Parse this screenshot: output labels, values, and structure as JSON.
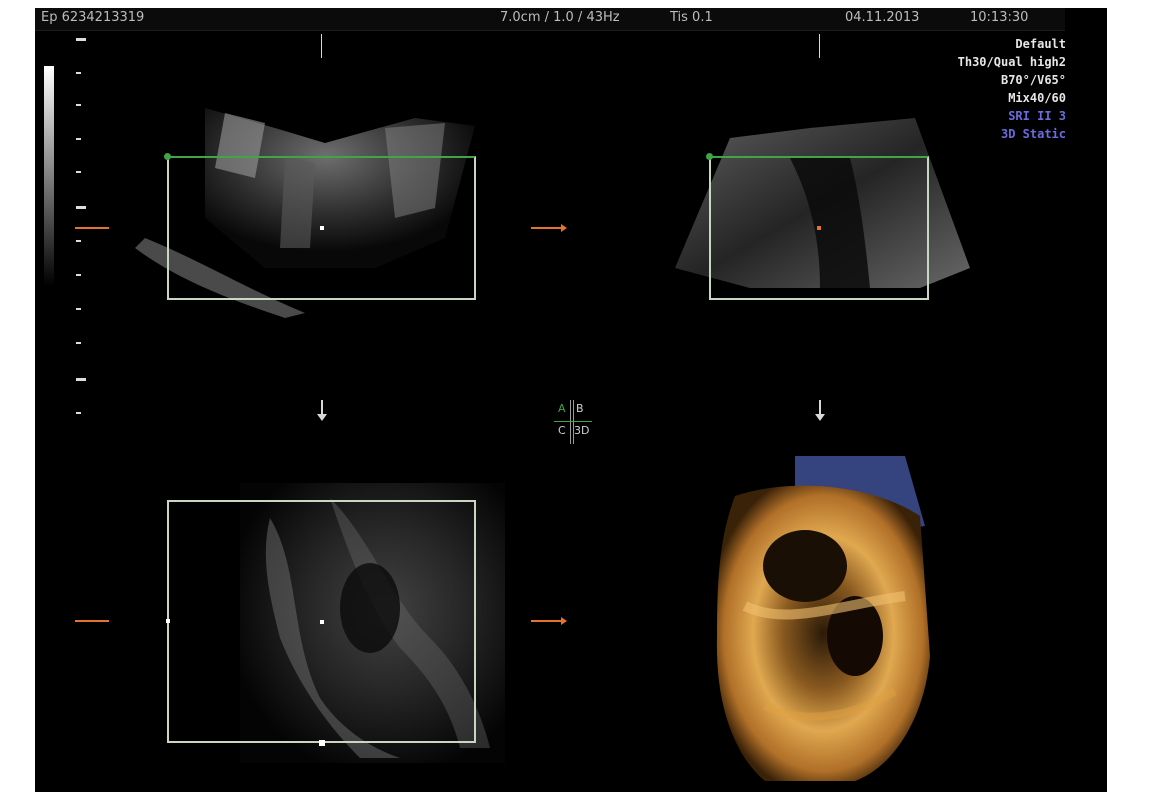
{
  "topbar": {
    "patient_id": "Ep  6234213319",
    "probe_info": "7.0cm / 1.0 / 43Hz",
    "ris": "Tis 0.1",
    "date": "04.11.2013",
    "time": "10:13:30"
  },
  "params": [
    {
      "text": "Default",
      "color": "#e6e6e6"
    },
    {
      "text": "Th30/Qual high2",
      "color": "#e6e6e6"
    },
    {
      "text": "B70°/V65°",
      "color": "#e6e6e6"
    },
    {
      "text": "Mix40/60",
      "color": "#e6e6e6"
    },
    {
      "text": "SRI II 3",
      "color": "#6b6bdf"
    },
    {
      "text": "3D Static",
      "color": "#6b6bdf"
    }
  ],
  "legend": {
    "a": "A",
    "b": "B",
    "c": "C",
    "d": "3D"
  },
  "colors": {
    "accent_green": "#3fa545",
    "roi_box": "#c9d7c2",
    "orange_marker": "#e3742f",
    "render_gold": "#d99a3a",
    "render_blue": "#3b4a8c"
  },
  "panels": [
    "plane-a",
    "plane-b",
    "plane-c",
    "3d-render"
  ]
}
